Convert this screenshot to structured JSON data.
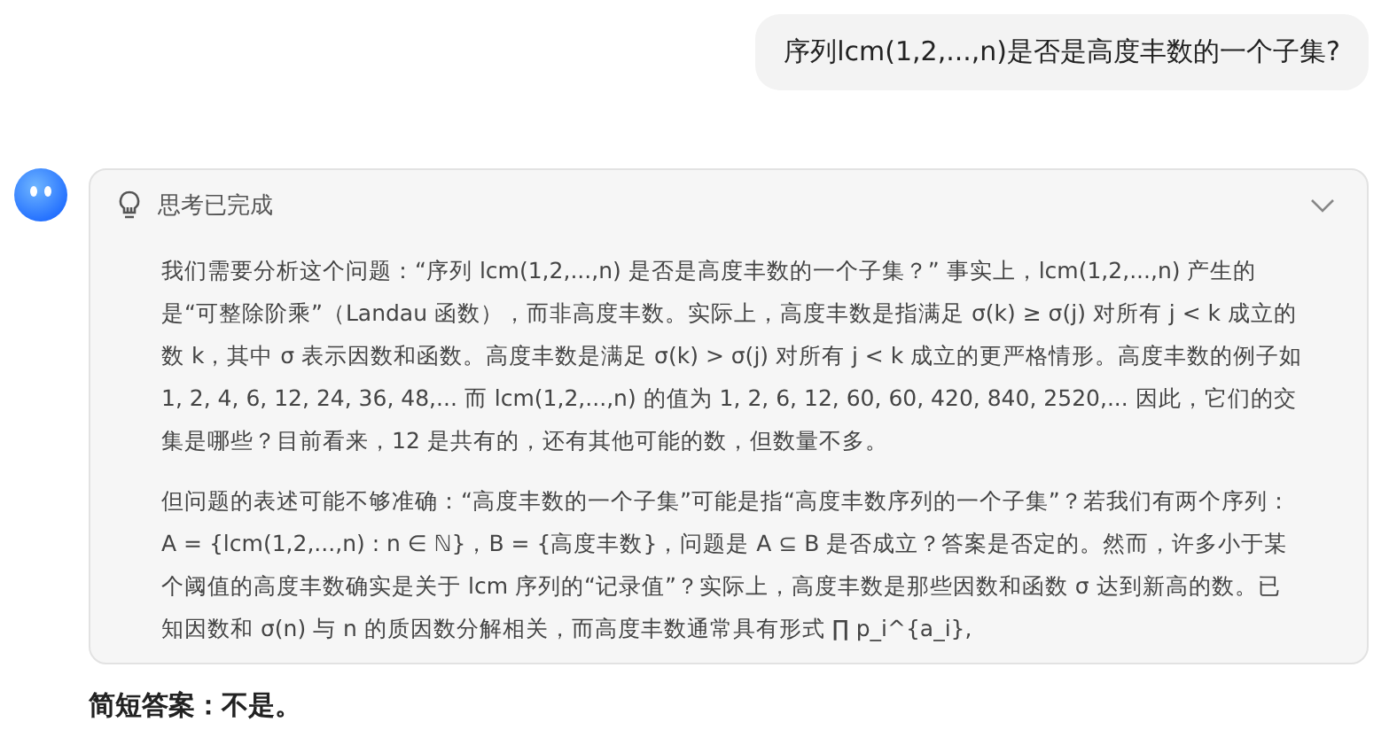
{
  "user_message": {
    "text": "序列lcm(1,2,...,n)是否是高度丰数的一个子集?"
  },
  "thinking": {
    "title": "思考已完成",
    "expanded": true,
    "paragraphs": [
      "我们需要分析这个问题：“序列 lcm(1,2,...,n) 是否是高度丰数的一个子集？” 事实上，lcm(1,2,...,n) 产生的是“可整除阶乘”（Landau 函数），而非高度丰数。实际上，高度丰数是指满足 σ(k) ≥ σ(j) 对所有 j < k 成立的数 k，其中 σ 表示因数和函数。高度丰数是满足 σ(k) > σ(j) 对所有 j < k 成立的更严格情形。高度丰数的例子如 1, 2, 4, 6, 12, 24, 36, 48,... 而 lcm(1,2,...,n) 的值为 1, 2, 6, 12, 60, 60, 420, 840, 2520,... 因此，它们的交集是哪些？目前看来，12 是共有的，还有其他可能的数，但数量不多。",
      "但问题的表述可能不够准确：“高度丰数的一个子集”可能是指“高度丰数序列的一个子集”？若我们有两个序列：A = {lcm(1,2,...,n) : n ∈ ℕ}，B = {高度丰数}，问题是 A ⊆ B 是否成立？答案是否定的。然而，许多小于某个阈值的高度丰数确实是关于 lcm 序列的“记录值”？实际上，高度丰数是那些因数和函数 σ 达到新高的数。已知因数和 σ(n) 与 n 的质因数分解相关，而高度丰数通常具有形式 ∏ p_i^{a_i},"
    ]
  },
  "answer": {
    "label": "简短答案：",
    "text": "不是。"
  }
}
